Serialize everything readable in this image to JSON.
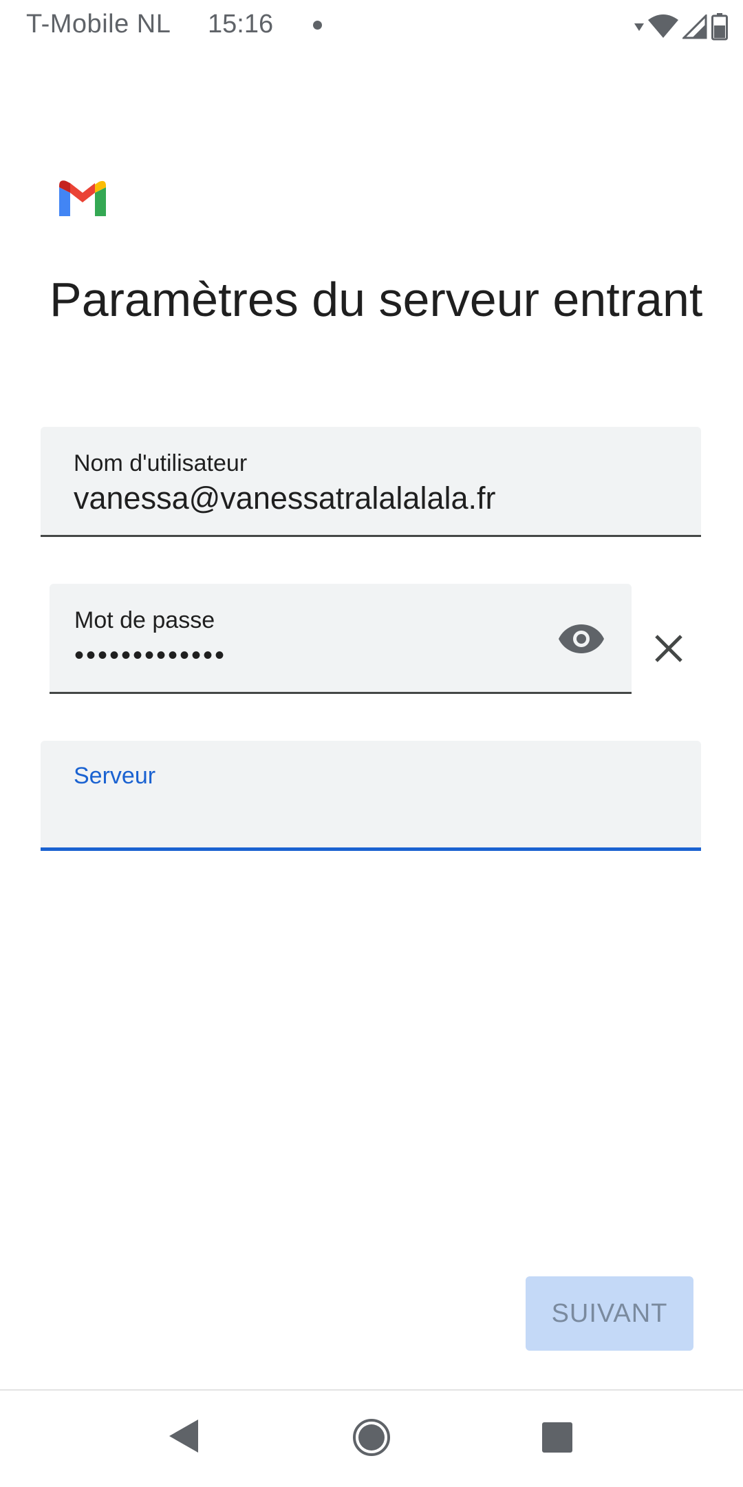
{
  "status_bar": {
    "carrier": "T-Mobile  NL",
    "time": "15:16"
  },
  "app": {
    "logo_icon": "gmail-logo"
  },
  "page": {
    "title": "Paramètres du serveur entrant"
  },
  "form": {
    "username": {
      "label": "Nom d'utilisateur",
      "value": "vanessa@vanessatralalalala.fr"
    },
    "password": {
      "label": "Mot de passe",
      "value": "•••••••••••••",
      "visibility_icon": "eye-icon",
      "clear_icon": "close-icon"
    },
    "server": {
      "label": "Serveur",
      "value": ""
    }
  },
  "actions": {
    "next_label": "SUIVANT"
  },
  "colors": {
    "accent": "#1a62d1",
    "field_background": "#f1f3f4",
    "button_disabled_bg": "#c4d9f7",
    "button_disabled_text": "#7a8a9e"
  }
}
